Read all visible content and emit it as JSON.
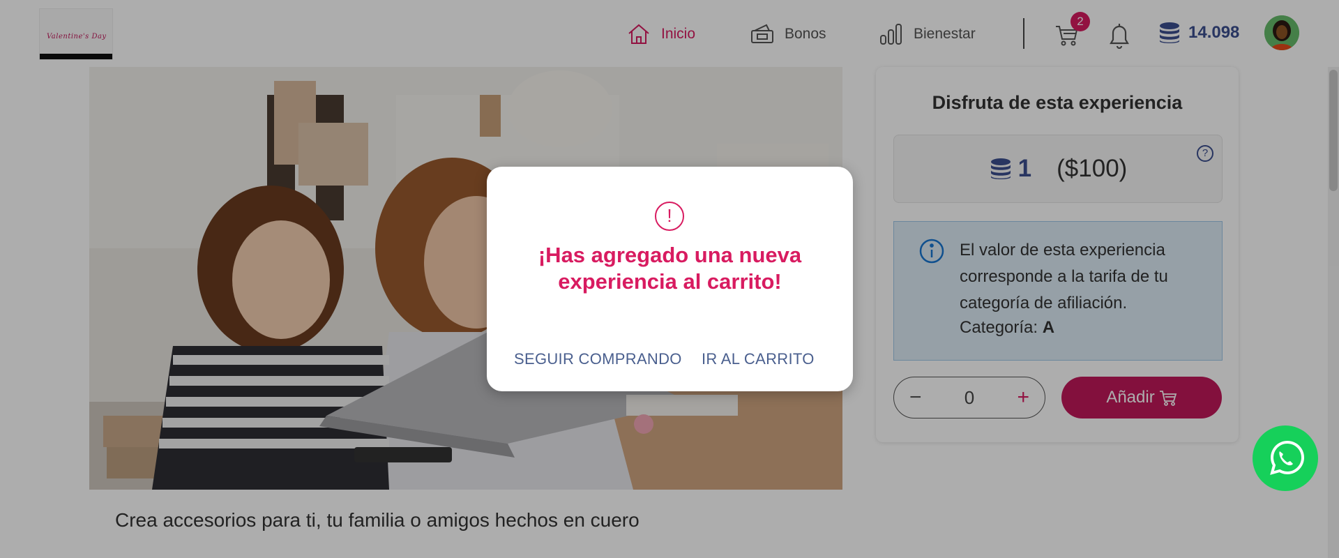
{
  "header": {
    "logo_text": "Valentine's Day",
    "nav": [
      {
        "label": "Inicio",
        "icon": "home-icon",
        "active": true
      },
      {
        "label": "Bonos",
        "icon": "ticket-icon",
        "active": false
      },
      {
        "label": "Bienestar",
        "icon": "bar-chart-icon",
        "active": false
      }
    ],
    "cart_count": "2",
    "coins_balance": "14.098"
  },
  "hero": {
    "title": "Crea accesorios para ti, tu familia o amigos hechos en cuero"
  },
  "side_panel": {
    "title": "Disfruta de esta experiencia",
    "price_coins": "1",
    "price_money": "($100)",
    "help_symbol": "?",
    "info_text": "El valor de esta experiencia corresponde a la tarifa de tu categoría de afiliación.",
    "category_label": "Categoría:",
    "category_value": "A",
    "quantity": "0",
    "add_label": "Añadir"
  },
  "modal": {
    "icon_symbol": "!",
    "title": "¡Has agregado una nueva experiencia al carrito!",
    "continue_label": "SEGUIR COMPRANDO",
    "cart_label": "IR AL CARRITO"
  },
  "colors": {
    "brand_pink": "#d81b60",
    "brand_navy": "#3c4f8f",
    "whatsapp_green": "#16d05a",
    "info_bg": "#ddecf7"
  }
}
